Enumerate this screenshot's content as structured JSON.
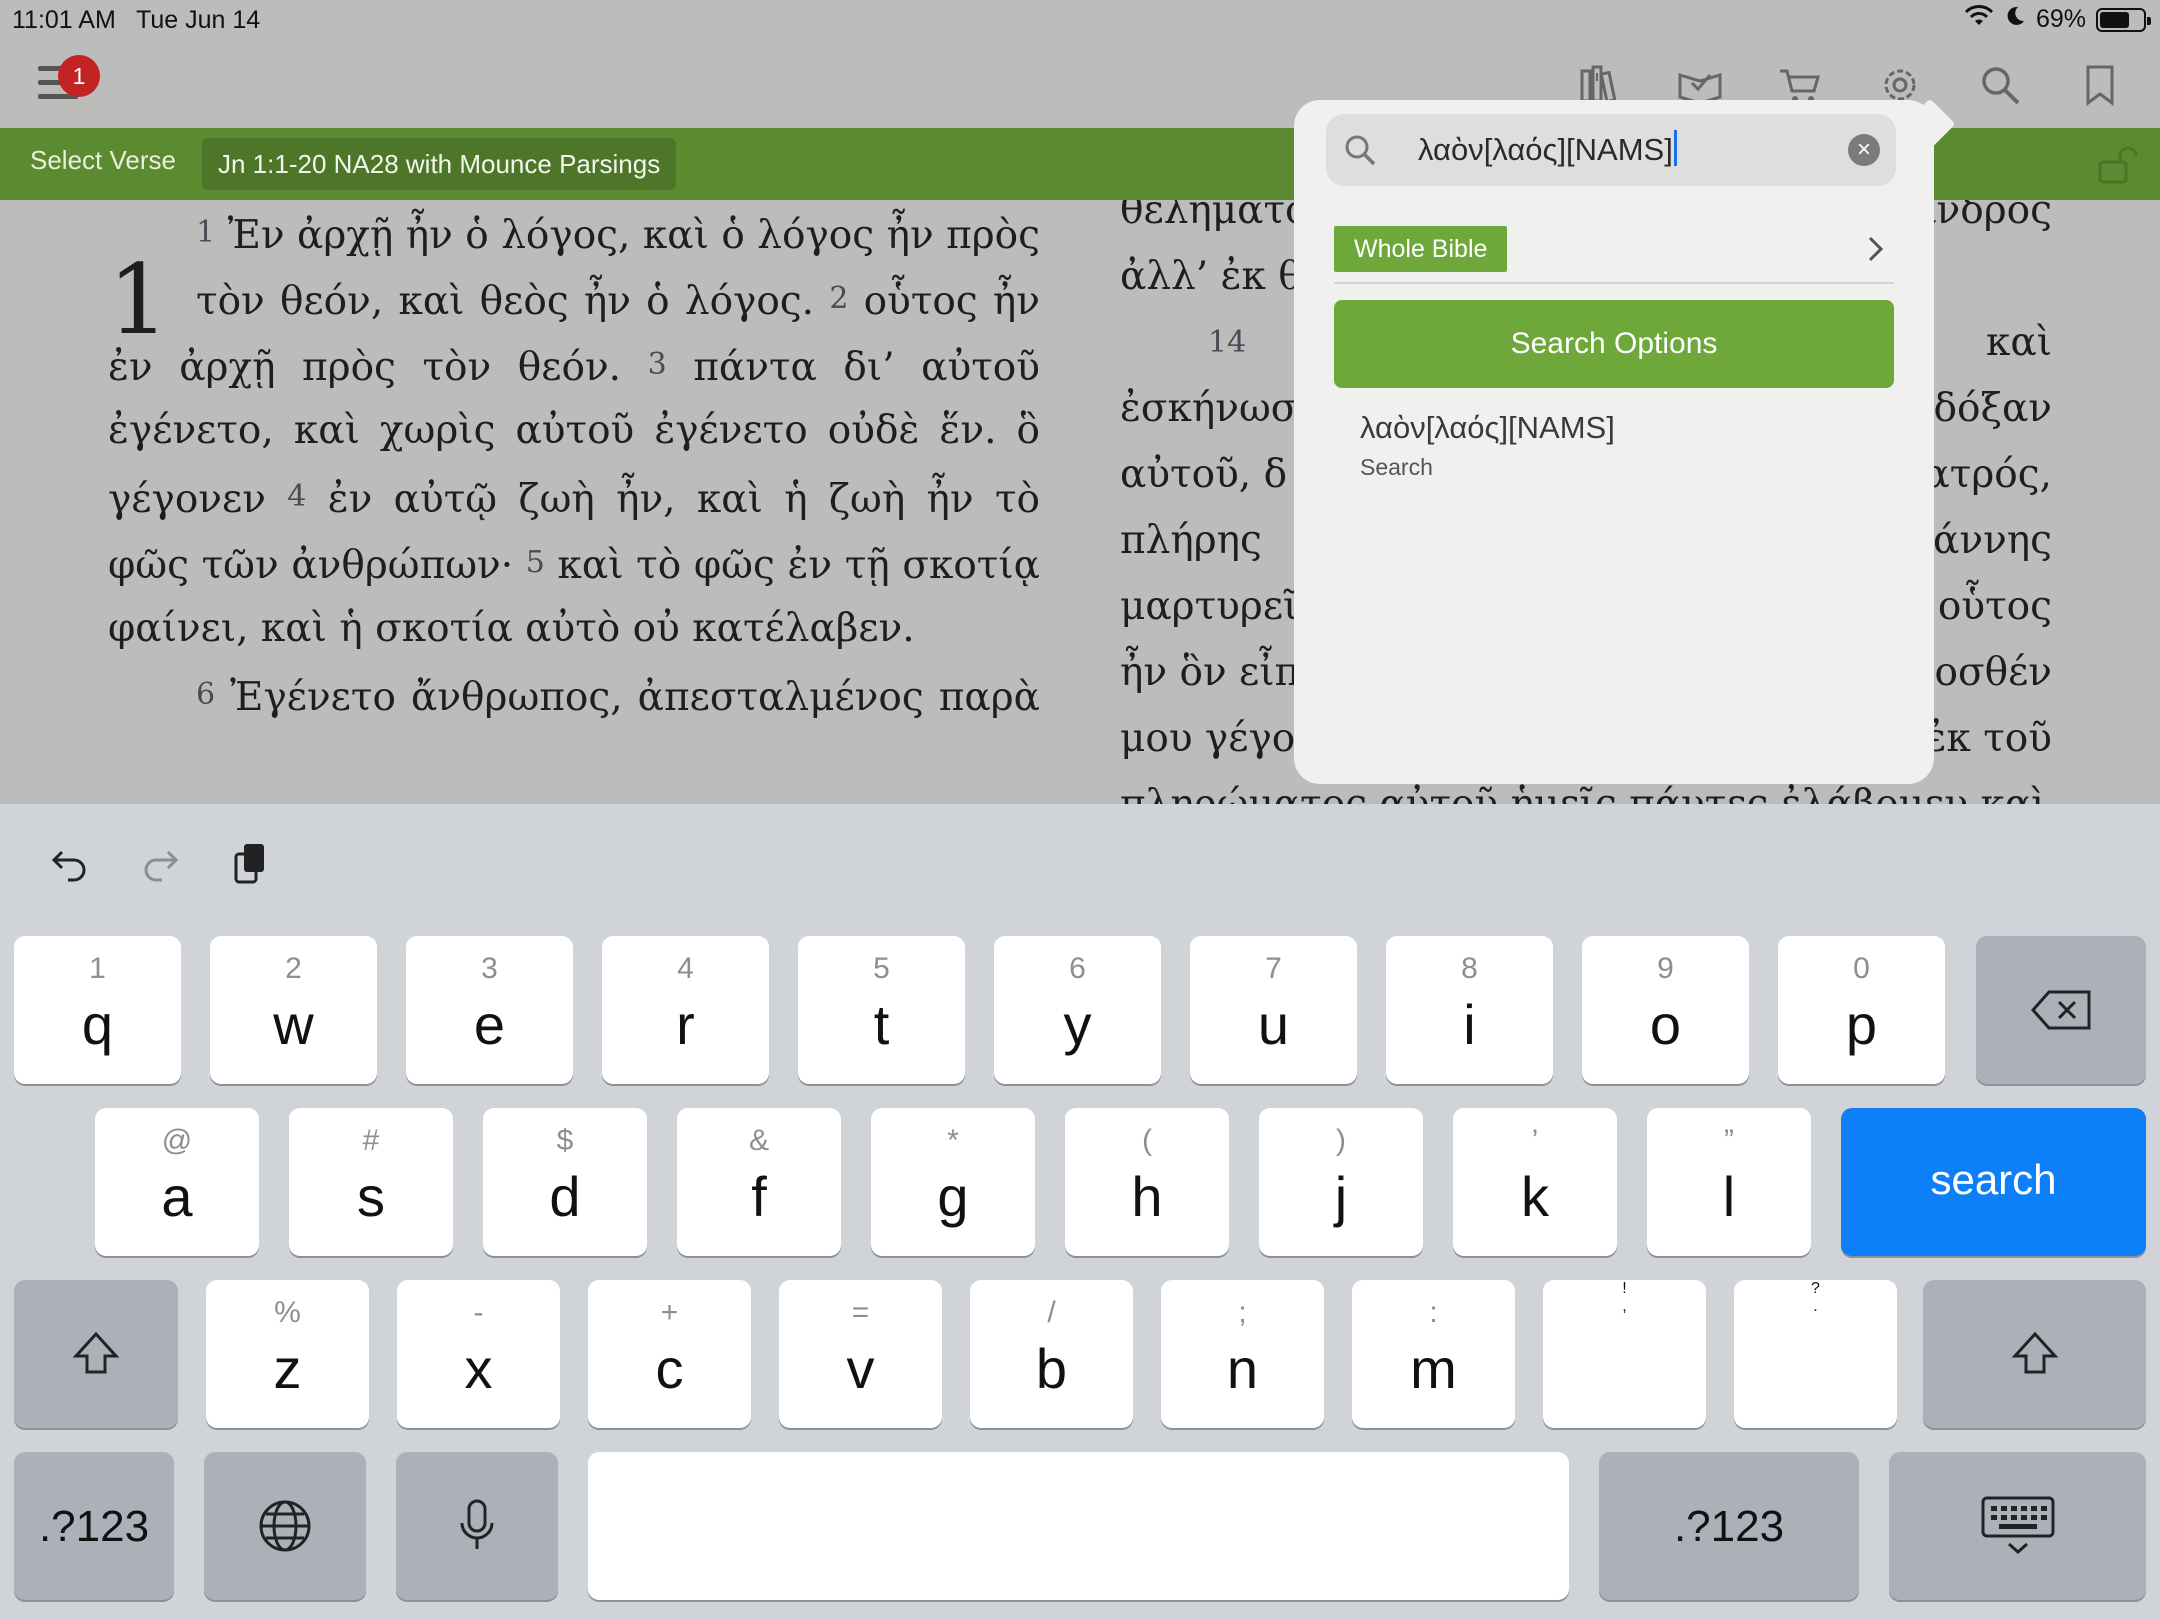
{
  "status": {
    "time": "11:01 AM",
    "date": "Tue Jun 14",
    "battery": "69%",
    "battery_level": 0.69
  },
  "toolbar": {
    "menu_badge": "1",
    "icons": [
      "library-icon",
      "reading-plan-icon",
      "cart-icon",
      "settings-icon",
      "search-icon",
      "bookmark-icon"
    ]
  },
  "header": {
    "select_verse": "Select Verse",
    "reference": "Jn 1:1-20 NA28 with Mounce Parsings"
  },
  "passage": {
    "chapter": "1",
    "left_lines": [
      {
        "v": "1",
        "t": "Ἐν ἀρχῇ ἦν ὁ λόγος, καὶ ὁ λόγος ἦν πρὸς"
      },
      {
        "t": "τὸν θεόν, καὶ θεὸς ἦν ὁ λόγος.",
        "v2": "2",
        "t2": "οὗτος ἦν"
      },
      {
        "t": "ἐν ἀρχῇ πρὸς τὸν θεόν.",
        "v2": "3",
        "t2": "πάντα δι’ αὐτοῦ"
      },
      {
        "t": "ἐγένετο, καὶ χωρὶς αὐτοῦ ἐγένετο οὐδὲ ἕν. ὃ"
      },
      {
        "t": "γέγονεν",
        "v2": "4",
        "t2": "ἐν αὐτῷ ζωὴ ἦν, καὶ ἡ ζωὴ ἦν τὸ"
      },
      {
        "t": "φῶς τῶν ἀνθρώπων·",
        "v2": "5",
        "t2": "καὶ τὸ φῶς ἐν τῇ σκοτίᾳ"
      },
      {
        "t": "φαίνει, καὶ ἡ σκοτία αὐτὸ οὐ κατέλαβεν."
      },
      {
        "v": "6",
        "t": "Ἐγένετο ἄνθρωπος, ἀπεσταλμένος παρὰ"
      }
    ],
    "right_lines": [
      {
        "a": "θελήματο",
        "b": "ἀνδρὸς"
      },
      {
        "a": "ἀλλ’ ἐκ θ",
        "b": ""
      },
      {
        "v": "14",
        "a": "",
        "b": "καὶ"
      },
      {
        "a": "ἐσκήνωσ",
        "b": "δόξαν"
      },
      {
        "a": "αὐτοῦ, δ",
        "b": "πατρός,"
      },
      {
        "a": "πλήρης",
        "b": "ωάννης"
      },
      {
        "a": "μαρτυρεῖ",
        "b": "οὗτος"
      },
      {
        "a": "ἦν ὃν εἶπ",
        "b": "ροσθέν"
      },
      {
        "a": "μου γέγο",
        "b": "ἐκ τοῦ"
      },
      {
        "a": "πληρώματος αὐτοῦ ἡμεῖς πάντες ἐλάβομεν καὶ",
        "b": ""
      }
    ]
  },
  "search_popover": {
    "query": "λαὸν[λαός][NAMS]",
    "scope": "Whole Bible",
    "options_button": "Search Options",
    "recent": [
      {
        "title": "λαὸν[λαός][NAMS]",
        "subtitle": "Search"
      }
    ]
  },
  "keyboard": {
    "row1": [
      {
        "hint": "1",
        "key": "q"
      },
      {
        "hint": "2",
        "key": "w"
      },
      {
        "hint": "3",
        "key": "e"
      },
      {
        "hint": "4",
        "key": "r"
      },
      {
        "hint": "5",
        "key": "t"
      },
      {
        "hint": "6",
        "key": "y"
      },
      {
        "hint": "7",
        "key": "u"
      },
      {
        "hint": "8",
        "key": "i"
      },
      {
        "hint": "9",
        "key": "o"
      },
      {
        "hint": "0",
        "key": "p"
      }
    ],
    "row2": [
      {
        "hint": "@",
        "key": "a"
      },
      {
        "hint": "#",
        "key": "s"
      },
      {
        "hint": "$",
        "key": "d"
      },
      {
        "hint": "&",
        "key": "f"
      },
      {
        "hint": "*",
        "key": "g"
      },
      {
        "hint": "(",
        "key": "h"
      },
      {
        "hint": ")",
        "key": "j"
      },
      {
        "hint": "’",
        "key": "k"
      },
      {
        "hint": "”",
        "key": "l"
      }
    ],
    "row3": [
      {
        "hint": "%",
        "key": "z"
      },
      {
        "hint": "-",
        "key": "x"
      },
      {
        "hint": "+",
        "key": "c"
      },
      {
        "hint": "=",
        "key": "v"
      },
      {
        "hint": "/",
        "key": "b"
      },
      {
        "hint": ";",
        "key": "n"
      },
      {
        "hint": ":",
        "key": "m"
      }
    ],
    "punct": [
      {
        "top": "!",
        "bottom": ","
      },
      {
        "top": "?",
        "bottom": "."
      }
    ],
    "search_label": "search",
    "numbers_label": ".?123"
  },
  "colors": {
    "accent_green": "#6ea73a",
    "header_green": "#5c8a31",
    "search_key_blue": "#0d7ff8",
    "badge_red": "#c42323"
  }
}
